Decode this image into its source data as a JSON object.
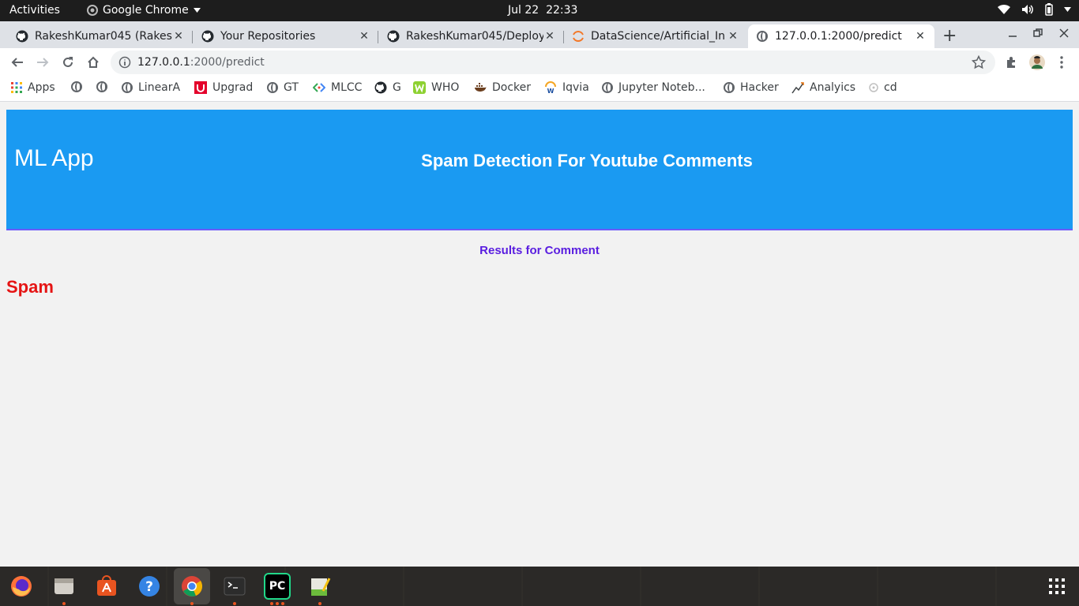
{
  "system_bar": {
    "activities": "Activities",
    "app_name": "Google Chrome",
    "date": "Jul 22",
    "time": "22:33"
  },
  "tabs": [
    {
      "title": "RakeshKumar045 (Rakesh",
      "icon": "github-icon"
    },
    {
      "title": "Your Repositories",
      "icon": "github-icon"
    },
    {
      "title": "RakeshKumar045/Deploy",
      "icon": "github-icon"
    },
    {
      "title": "DataScience/Artificial_In",
      "icon": "jupyter-icon"
    },
    {
      "title": "127.0.0.1:2000/predict",
      "icon": "globe-icon",
      "active": true
    }
  ],
  "tab_close": "✕",
  "new_tab": "+",
  "address_bar": {
    "host": "127.0.0.1",
    "path": ":2000/predict"
  },
  "bookmarks": [
    {
      "label": "Apps",
      "icon": "apps-grid-icon"
    },
    {
      "label": "",
      "icon": "globe-icon"
    },
    {
      "label": "",
      "icon": "globe-icon"
    },
    {
      "label": "LinearA",
      "icon": "globe-icon"
    },
    {
      "label": "Upgrad",
      "icon": "upgrad-icon"
    },
    {
      "label": "GT",
      "icon": "globe-icon"
    },
    {
      "label": "MLCC",
      "icon": "mlcc-icon"
    },
    {
      "label": "G",
      "icon": "github-icon"
    },
    {
      "label": "WHO",
      "icon": "who-icon"
    },
    {
      "label": "Docker",
      "icon": "docker-icon"
    },
    {
      "label": "Iqvia",
      "icon": "iqvia-icon"
    },
    {
      "label": "Jupyter Noteb...",
      "icon": "globe-icon"
    },
    {
      "label": "Hacker",
      "icon": "globe-icon"
    },
    {
      "label": "Analyics",
      "icon": "analytics-icon"
    },
    {
      "label": "cd",
      "icon": "cd-icon"
    }
  ],
  "page": {
    "brand": "ML App",
    "headline": "Spam Detection For Youtube Comments",
    "results_heading": "Results for Comment",
    "verdict": "Spam"
  },
  "dock": {
    "pycharm_label": "PC"
  },
  "colors": {
    "header_bg": "#1a9af2",
    "results_heading": "#5a1ee0",
    "verdict": "#e51414"
  }
}
